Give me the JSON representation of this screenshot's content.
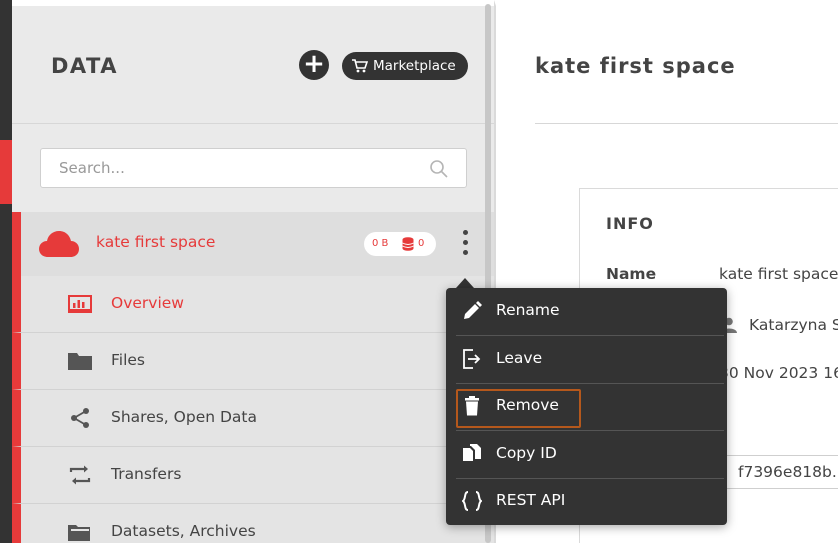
{
  "sidebar": {
    "title": "DATA",
    "add_label": "+",
    "marketplace_label": "Marketplace",
    "search_placeholder": "Search...",
    "space": {
      "name": "kate first space",
      "size": "0 B",
      "count": "0"
    },
    "nav": [
      {
        "label": "Overview",
        "icon": "overview-icon",
        "active": true
      },
      {
        "label": "Files",
        "icon": "folder-icon"
      },
      {
        "label": "Shares, Open Data",
        "icon": "share-icon"
      },
      {
        "label": "Transfers",
        "icon": "transfers-icon"
      },
      {
        "label": "Datasets, Archives",
        "icon": "datasets-icon"
      }
    ]
  },
  "main": {
    "title": "kate first space",
    "info": {
      "heading": "INFO",
      "name_label": "Name",
      "name_value": "kate first space",
      "owner": "Katarzyna S",
      "date": "30 Nov 2023 16",
      "id": "f7396e818b."
    }
  },
  "context_menu": {
    "items": [
      {
        "label": "Rename",
        "icon": "pencil-icon"
      },
      {
        "label": "Leave",
        "icon": "leave-icon"
      },
      {
        "label": "Remove",
        "icon": "trash-icon",
        "highlighted": true
      },
      {
        "label": "Copy ID",
        "icon": "copy-icon"
      },
      {
        "label": "REST API",
        "icon": "braces-icon"
      }
    ]
  },
  "colors": {
    "accent": "#e63a3a",
    "dark": "#333333",
    "highlight_border": "#b5581c"
  }
}
